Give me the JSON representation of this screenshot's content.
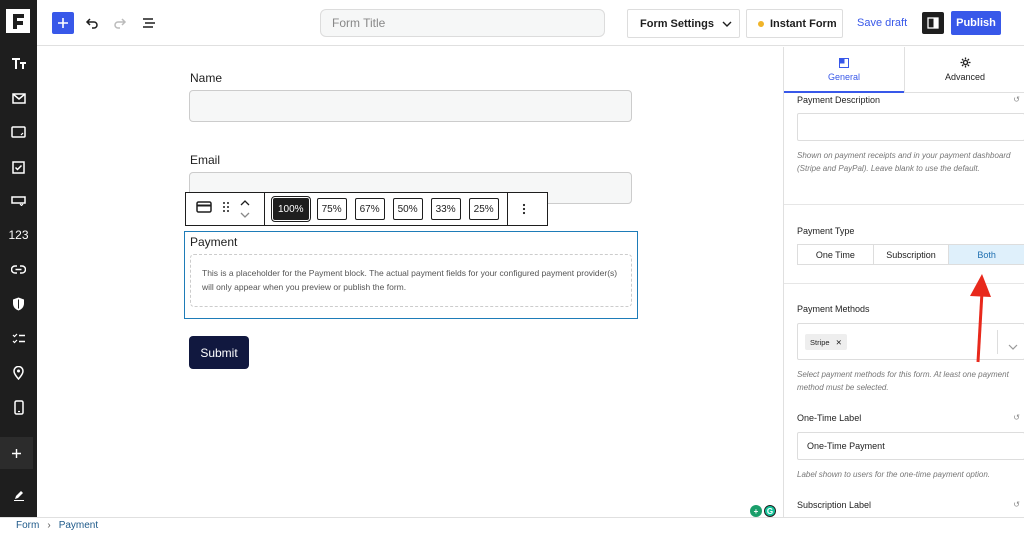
{
  "toolbar": {
    "form_title_placeholder": "Form Title",
    "form_settings_label": "Form Settings",
    "instant_form_label": "Instant Form",
    "save_draft_label": "Save draft",
    "publish_label": "Publish"
  },
  "rail": {
    "number_label": "123"
  },
  "canvas": {
    "name_label": "Name",
    "email_label": "Email",
    "width_options": [
      "100%",
      "75%",
      "67%",
      "50%",
      "33%",
      "25%"
    ],
    "selected_width": "100%",
    "payment_title": "Payment",
    "payment_placeholder": "This is a placeholder for the Payment block. The actual payment fields for your configured payment provider(s) will only appear when you preview or publish the form.",
    "submit_label": "Submit"
  },
  "sidebar": {
    "tabs": [
      {
        "label": "General",
        "active": true
      },
      {
        "label": "Advanced",
        "active": false
      }
    ],
    "payment_description_label": "Payment Description",
    "payment_description_value": "",
    "payment_description_help": "Shown on payment receipts and in your payment dashboard (Stripe and PayPal). Leave blank to use the default.",
    "payment_type_label": "Payment Type",
    "payment_type_options": [
      "One Time",
      "Subscription",
      "Both"
    ],
    "payment_type_selected": "Both",
    "payment_methods_label": "Payment Methods",
    "payment_methods_selected": [
      "Stripe"
    ],
    "payment_methods_help": "Select payment methods for this form. At least one payment method must be selected.",
    "one_time_label_title": "One-Time Label",
    "one_time_label_value": "One-Time Payment",
    "one_time_label_help": "Label shown to users for the one-time payment option.",
    "subscription_label_title": "Subscription Label"
  },
  "breadcrumb": [
    "Form",
    "Payment"
  ],
  "colors": {
    "accent": "#3858e9",
    "submit": "#11183f",
    "selected_block_border": "#1e7cb8",
    "annotation_arrow": "#e8291c"
  }
}
